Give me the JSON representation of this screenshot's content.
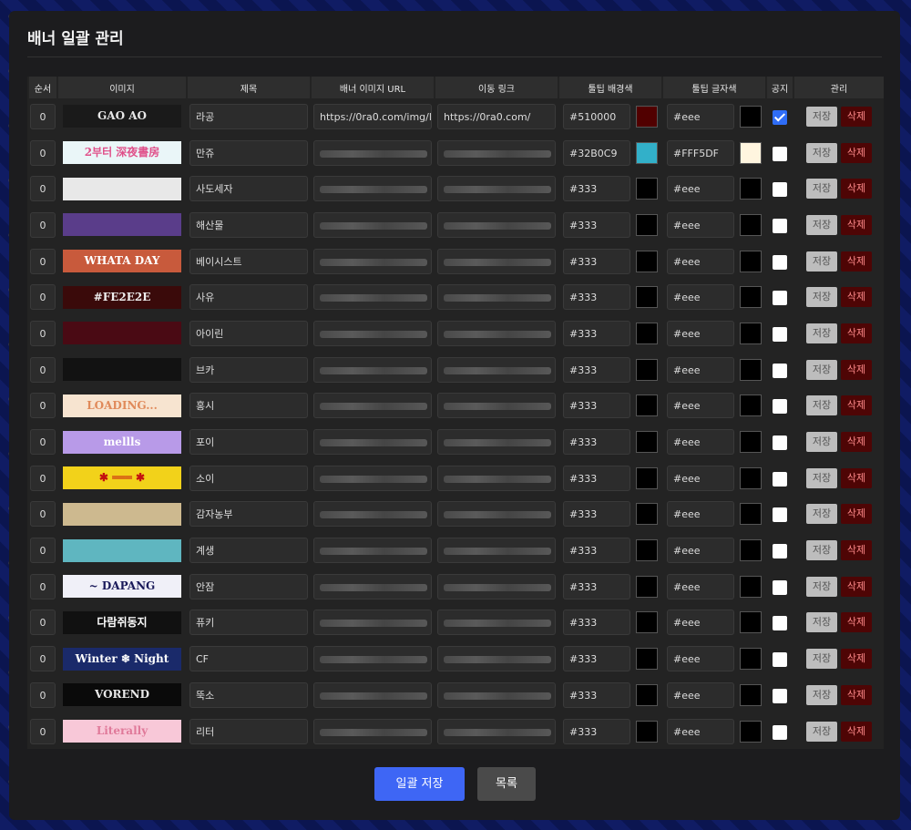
{
  "modal": {
    "title": "배너 일괄 관리"
  },
  "columns": [
    "순서",
    "이미지",
    "제목",
    "배너 이미지 URL",
    "이동 링크",
    "툴팁 배경색",
    "툴팁 글자색",
    "공지",
    "관리"
  ],
  "actions": {
    "save": "저장",
    "delete": "삭제"
  },
  "footer": {
    "bulk_save": "일괄 저장",
    "list": "목록"
  },
  "rows": [
    {
      "order": "0",
      "title": "라공",
      "url": "https://0ra0.com/img/l",
      "link": "https://0ra0.com/",
      "bg": "#510000",
      "bg_swatch": "#510000",
      "fg": "#eee",
      "fg_swatch": "#000000",
      "notice": true,
      "banner_text": "GAO AO",
      "banner_bg": "#1a1a1a",
      "banner_fg": "#e8e8e8"
    },
    {
      "order": "0",
      "title": "만쥬",
      "url": "",
      "link": "",
      "bg": "#32B0C9",
      "bg_swatch": "#32B0C9",
      "fg": "#FFF5DF",
      "fg_swatch": "#FFF5DF",
      "notice": false,
      "banner_text": "2부터 深夜書房",
      "banner_bg": "#eaf6f8",
      "banner_fg": "#e0508a"
    },
    {
      "order": "0",
      "title": "사도세자",
      "url": "",
      "link": "",
      "bg": "#333",
      "bg_swatch": "#000000",
      "fg": "#eee",
      "fg_swatch": "#000000",
      "notice": false,
      "banner_text": "",
      "banner_bg": "#e8e8e8",
      "banner_fg": "#111"
    },
    {
      "order": "0",
      "title": "해산물",
      "url": "",
      "link": "",
      "bg": "#333",
      "bg_swatch": "#000000",
      "fg": "#eee",
      "fg_swatch": "#000000",
      "notice": false,
      "banner_text": "",
      "banner_bg": "#5a3d8a",
      "banner_fg": "#fff"
    },
    {
      "order": "0",
      "title": "베이시스트",
      "url": "",
      "link": "",
      "bg": "#333",
      "bg_swatch": "#000000",
      "fg": "#eee",
      "fg_swatch": "#000000",
      "notice": false,
      "banner_text": "WHATA DAY",
      "banner_bg": "#c85a3c",
      "banner_fg": "#fff"
    },
    {
      "order": "0",
      "title": "사유",
      "url": "",
      "link": "",
      "bg": "#333",
      "bg_swatch": "#000000",
      "fg": "#eee",
      "fg_swatch": "#000000",
      "notice": false,
      "banner_text": "#FE2E2E",
      "banner_bg": "#3a0a0a",
      "banner_fg": "#f0f0f0"
    },
    {
      "order": "0",
      "title": "아이린",
      "url": "",
      "link": "",
      "bg": "#333",
      "bg_swatch": "#000000",
      "fg": "#eee",
      "fg_swatch": "#000000",
      "notice": false,
      "banner_text": "",
      "banner_bg": "#4a0a14",
      "banner_fg": "#fff"
    },
    {
      "order": "0",
      "title": "브카",
      "url": "",
      "link": "",
      "bg": "#333",
      "bg_swatch": "#000000",
      "fg": "#eee",
      "fg_swatch": "#000000",
      "notice": false,
      "banner_text": "",
      "banner_bg": "#121212",
      "banner_fg": "#fff"
    },
    {
      "order": "0",
      "title": "홍시",
      "url": "",
      "link": "",
      "bg": "#333",
      "bg_swatch": "#000000",
      "fg": "#eee",
      "fg_swatch": "#000000",
      "notice": false,
      "banner_text": "LOADING...",
      "banner_bg": "#f7e4d0",
      "banner_fg": "#e08a5a"
    },
    {
      "order": "0",
      "title": "포이",
      "url": "",
      "link": "",
      "bg": "#333",
      "bg_swatch": "#000000",
      "fg": "#eee",
      "fg_swatch": "#000000",
      "notice": false,
      "banner_text": "mellls",
      "banner_bg": "#b89ae8",
      "banner_fg": "#fff"
    },
    {
      "order": "0",
      "title": "소이",
      "url": "",
      "link": "",
      "bg": "#333",
      "bg_swatch": "#000000",
      "fg": "#eee",
      "fg_swatch": "#000000",
      "notice": false,
      "banner_text": "✱ ═══ ✱",
      "banner_bg": "#f2d21a",
      "banner_fg": "#c41010"
    },
    {
      "order": "0",
      "title": "감자농부",
      "url": "",
      "link": "",
      "bg": "#333",
      "bg_swatch": "#000000",
      "fg": "#eee",
      "fg_swatch": "#000000",
      "notice": false,
      "banner_text": "",
      "banner_bg": "#cdb98f",
      "banner_fg": "#5a4020"
    },
    {
      "order": "0",
      "title": "계생",
      "url": "",
      "link": "",
      "bg": "#333",
      "bg_swatch": "#000000",
      "fg": "#eee",
      "fg_swatch": "#000000",
      "notice": false,
      "banner_text": "",
      "banner_bg": "#5fb6c0",
      "banner_fg": "#fff"
    },
    {
      "order": "0",
      "title": "안잠",
      "url": "",
      "link": "",
      "bg": "#333",
      "bg_swatch": "#000000",
      "fg": "#eee",
      "fg_swatch": "#000000",
      "notice": false,
      "banner_text": "~ DAPANG",
      "banner_bg": "#f0f0f8",
      "banner_fg": "#1a1a5a"
    },
    {
      "order": "0",
      "title": "퓨키",
      "url": "",
      "link": "",
      "bg": "#333",
      "bg_swatch": "#000000",
      "fg": "#eee",
      "fg_swatch": "#000000",
      "notice": false,
      "banner_text": "다람쥐동지",
      "banner_bg": "#111111",
      "banner_fg": "#ffffff"
    },
    {
      "order": "0",
      "title": "CF",
      "url": "",
      "link": "",
      "bg": "#333",
      "bg_swatch": "#000000",
      "fg": "#eee",
      "fg_swatch": "#000000",
      "notice": false,
      "banner_text": "Winter ❄ Night",
      "banner_bg": "#1a2a6a",
      "banner_fg": "#ffffff"
    },
    {
      "order": "0",
      "title": "뚝소",
      "url": "",
      "link": "",
      "bg": "#333",
      "bg_swatch": "#000000",
      "fg": "#eee",
      "fg_swatch": "#000000",
      "notice": false,
      "banner_text": "VOREND",
      "banner_bg": "#0a0a0a",
      "banner_fg": "#e8e8e8"
    },
    {
      "order": "0",
      "title": "리터",
      "url": "",
      "link": "",
      "bg": "#333",
      "bg_swatch": "#000000",
      "fg": "#eee",
      "fg_swatch": "#000000",
      "notice": false,
      "banner_text": "Literally",
      "banner_bg": "#f8c8d8",
      "banner_fg": "#e07a9a"
    }
  ]
}
